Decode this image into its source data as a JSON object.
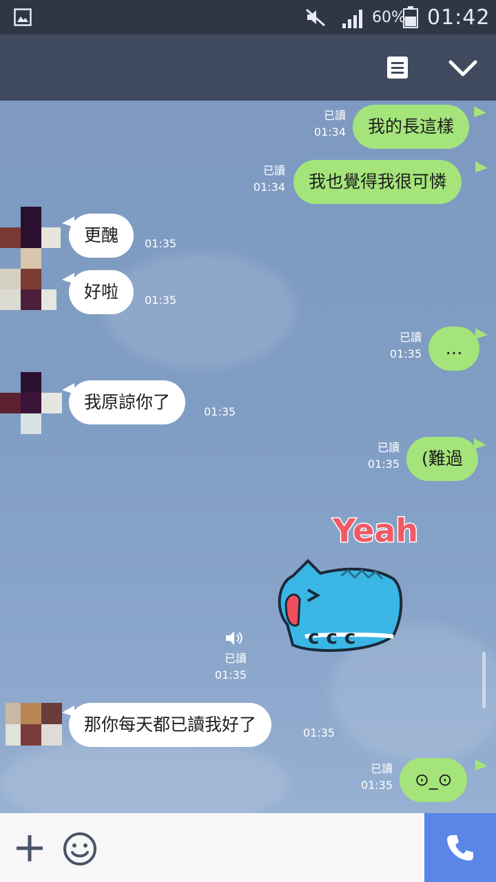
{
  "status_bar": {
    "battery_percent": "60%",
    "time": "01:42",
    "icons": [
      "gallery-icon",
      "mute-icon",
      "signal-icon",
      "battery-icon"
    ]
  },
  "header": {
    "title": "",
    "icons": [
      "notes-icon",
      "chevron-down-icon"
    ]
  },
  "messages": [
    {
      "side": "out",
      "text": "我的長這樣",
      "read": "已讀",
      "time": "01:34"
    },
    {
      "side": "out",
      "text": "我也覺得我很可憐",
      "read": "已讀",
      "time": "01:34"
    },
    {
      "side": "in",
      "text": "更醜",
      "time": "01:35"
    },
    {
      "side": "in",
      "text": "好啦",
      "time": "01:35"
    },
    {
      "side": "out",
      "text": "…",
      "read": "已讀",
      "time": "01:35"
    },
    {
      "side": "in",
      "text": "我原諒你了",
      "time": "01:35"
    },
    {
      "side": "out",
      "text": "(難過",
      "read": "已讀",
      "time": "01:35"
    },
    {
      "side": "out",
      "type": "sticker",
      "sticker_text": "Yeah",
      "read": "已讀",
      "time": "01:35"
    },
    {
      "side": "in",
      "text": "那你每天都已讀我好了",
      "time": "01:35"
    },
    {
      "side": "out",
      "text": "⊙_⊙",
      "read": "已讀",
      "time": "01:35"
    }
  ],
  "input_bar": {
    "icons": [
      "plus-icon",
      "emoji-icon",
      "phone-icon"
    ]
  },
  "colors": {
    "outgoing_bubble": "#a4e47a",
    "incoming_bubble": "#ffffff",
    "chat_background": "#7f9bc2",
    "call_button": "#5a86e8"
  }
}
